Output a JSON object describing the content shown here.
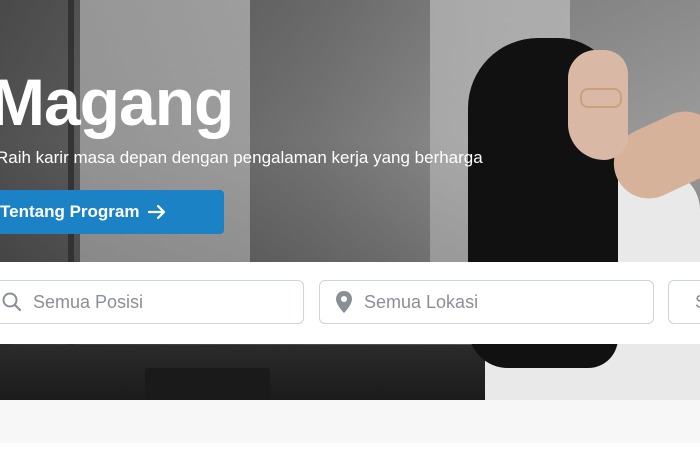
{
  "hero": {
    "title": "Magang",
    "subtitle": "Raih karir masa depan dengan pengalaman kerja yang berharga",
    "cta_label": "Tentang Program"
  },
  "search": {
    "position_placeholder": "Semua Posisi",
    "location_placeholder": "Semua Lokasi",
    "company_placeholder": "Semua Perusahaan"
  },
  "icons": {
    "cta": "arrow-right-icon",
    "position": "search-icon",
    "location": "map-pin-icon",
    "company": "building-icon"
  },
  "colors": {
    "accent": "#1a82c5",
    "title_text": "#ffffff",
    "placeholder": "#8a8f96",
    "field_border": "#cfd4da"
  }
}
